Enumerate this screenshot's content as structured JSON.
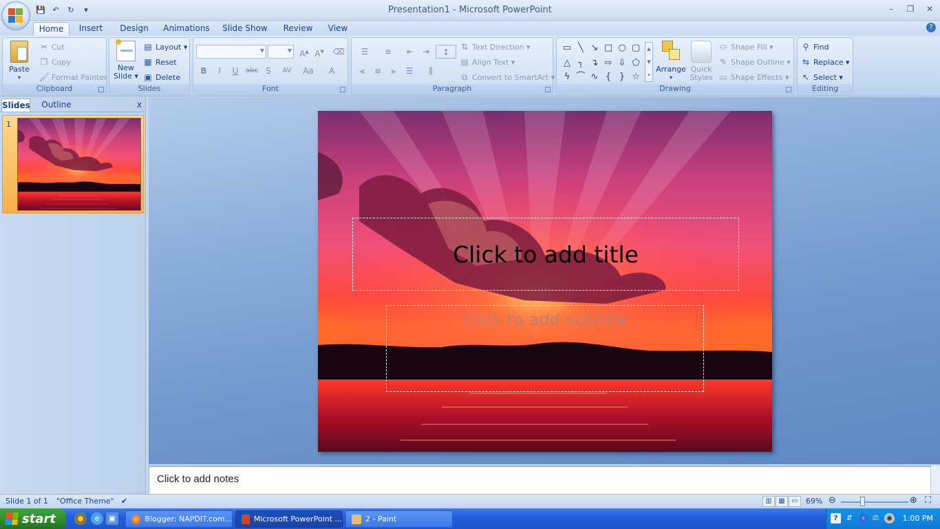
{
  "window": {
    "title": "Presentation1 - Microsoft PowerPoint",
    "minimize": "–",
    "restore": "❐",
    "close": "✕"
  },
  "quick_access": {
    "save": "💾",
    "undo": "↶",
    "redo": "↻",
    "customize": "▾"
  },
  "tabs": [
    "Home",
    "Insert",
    "Design",
    "Animations",
    "Slide Show",
    "Review",
    "View"
  ],
  "active_tab": "Home",
  "help": "?",
  "ribbon": {
    "clipboard": {
      "label": "Clipboard",
      "paste": "Paste",
      "cut": "Cut",
      "copy": "Copy",
      "format_painter": "Format Painter"
    },
    "slides": {
      "label": "Slides",
      "new_slide_1": "New",
      "new_slide_2": "Slide ▾",
      "layout": "Layout ▾",
      "reset": "Reset",
      "delete": "Delete"
    },
    "font": {
      "label": "Font",
      "font_name": "",
      "font_size": "",
      "bold": "B",
      "italic": "I",
      "underline": "U",
      "strike": "abc",
      "shadow": "S",
      "spacing": "AV",
      "case": "Aa",
      "color": "A"
    },
    "paragraph": {
      "label": "Paragraph",
      "text_direction": "Text Direction ▾",
      "align_text": "Align Text ▾",
      "smartart": "Convert to SmartArt ▾"
    },
    "drawing": {
      "label": "Drawing",
      "arrange": "Arrange",
      "quick_styles_1": "Quick",
      "quick_styles_2": "Styles ▾",
      "shape_fill": "Shape Fill ▾",
      "shape_outline": "Shape Outline ▾",
      "shape_effects": "Shape Effects ▾"
    },
    "editing": {
      "label": "Editing",
      "find": "Find",
      "replace": "Replace ▾",
      "select": "Select ▾"
    }
  },
  "left_pane": {
    "tab_slides": "Slides",
    "tab_outline": "Outline",
    "close": "x",
    "slide_number": "1"
  },
  "slide": {
    "title_placeholder": "Click to add title",
    "subtitle_placeholder": "Click to add subtitle"
  },
  "notes_placeholder": "Click to add notes",
  "status": {
    "slide_of": "Slide 1 of 1",
    "theme": "\"Office Theme\"",
    "zoom": "69%"
  },
  "taskbar": {
    "start": "start",
    "tasks": [
      "Blogger: NAPDIT.com...",
      "Microsoft PowerPoint ...",
      "2 - Paint"
    ],
    "clock": "1:00 PM"
  },
  "colors": {
    "accent": "#15428b",
    "taskbar": "#245edb",
    "start": "#2d8a2d"
  }
}
